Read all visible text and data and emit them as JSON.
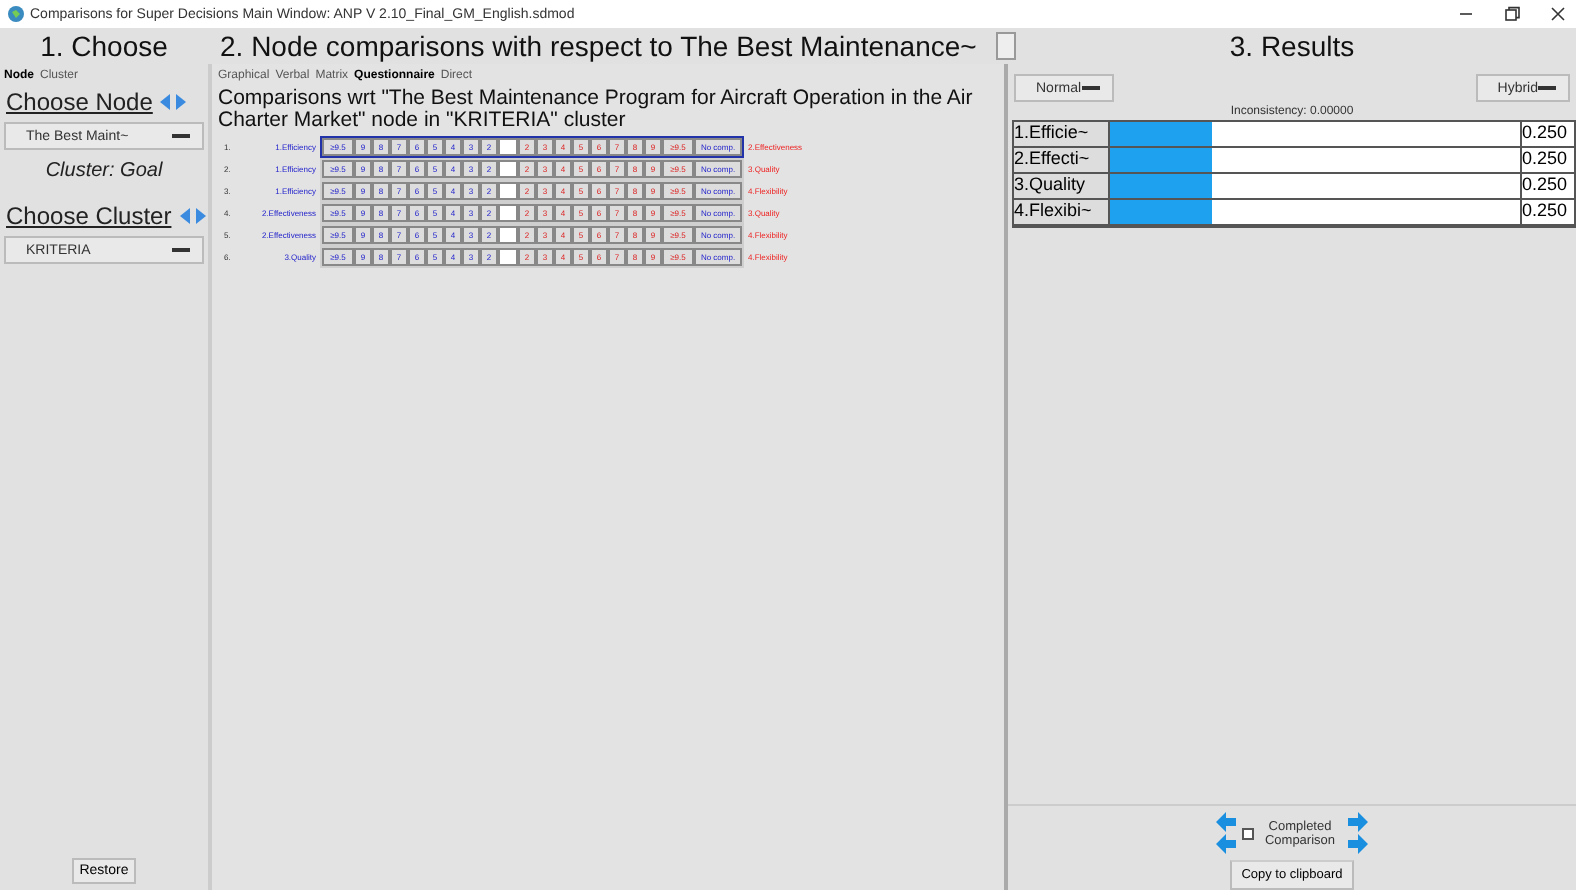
{
  "window": {
    "title": "Comparisons for Super Decisions Main Window: ANP V 2.10_Final_GM_English.sdmod"
  },
  "headers": [
    "1. Choose",
    "2. Node comparisons with respect to The Best Maintenance~",
    "3. Results"
  ],
  "choose": {
    "tabs": [
      {
        "label": "Node",
        "selected": true
      },
      {
        "label": "Cluster",
        "selected": false
      }
    ],
    "node_heading": "Choose Node",
    "node_select": "The Best Maint~",
    "cluster_info": "Cluster: Goal",
    "cluster_heading": "Choose Cluster",
    "cluster_select": "KRITERIA",
    "restore": "Restore"
  },
  "comparisons": {
    "tabs": [
      {
        "label": "Graphical",
        "selected": false
      },
      {
        "label": "Verbal",
        "selected": false
      },
      {
        "label": "Matrix",
        "selected": false
      },
      {
        "label": "Questionnaire",
        "selected": true
      },
      {
        "label": "Direct",
        "selected": false
      }
    ],
    "heading": "Comparisons wrt \"The Best Maintenance Program for Aircraft Operation in the Air Charter Market\" node in \"KRITERIA\" cluster",
    "rows": [
      {
        "number": "1.",
        "left": "1.Efficiency",
        "right": "2.Effectiveness",
        "selected": true,
        "left_scale": [
          "≥9.5",
          "9",
          "8",
          "7",
          "6",
          "5",
          "4",
          "3",
          "2"
        ],
        "right_scale": [
          "2",
          "3",
          "4",
          "5",
          "6",
          "7",
          "8",
          "9",
          "≥9.5",
          "No comp."
        ]
      },
      {
        "number": "2.",
        "left": "1.Efficiency",
        "right": "3.Quality",
        "selected": false,
        "left_scale": [
          "≥9.5",
          "9",
          "8",
          "7",
          "6",
          "5",
          "4",
          "3",
          "2"
        ],
        "right_scale": [
          "2",
          "3",
          "4",
          "5",
          "6",
          "7",
          "8",
          "9",
          "≥9.5",
          "No comp."
        ]
      },
      {
        "number": "3.",
        "left": "1.Efficiency",
        "right": "4.Flexibility",
        "selected": false,
        "left_scale": [
          "≥9.5",
          "9",
          "8",
          "7",
          "6",
          "5",
          "4",
          "3",
          "2"
        ],
        "right_scale": [
          "2",
          "3",
          "4",
          "5",
          "6",
          "7",
          "8",
          "9",
          "≥9.5",
          "No comp."
        ]
      },
      {
        "number": "4.",
        "left": "2.Effectiveness",
        "right": "3.Quality",
        "selected": false,
        "left_scale": [
          "≥9.5",
          "9",
          "8",
          "7",
          "6",
          "5",
          "4",
          "3",
          "2"
        ],
        "right_scale": [
          "2",
          "3",
          "4",
          "5",
          "6",
          "7",
          "8",
          "9",
          "≥9.5",
          "No comp."
        ]
      },
      {
        "number": "5.",
        "left": "2.Effectiveness",
        "right": "4.Flexibility",
        "selected": false,
        "left_scale": [
          "≥9.5",
          "9",
          "8",
          "7",
          "6",
          "5",
          "4",
          "3",
          "2"
        ],
        "right_scale": [
          "2",
          "3",
          "4",
          "5",
          "6",
          "7",
          "8",
          "9",
          "≥9.5",
          "No comp."
        ]
      },
      {
        "number": "6.",
        "left": "3.Quality",
        "right": "4.Flexibility",
        "selected": false,
        "left_scale": [
          "≥9.5",
          "9",
          "8",
          "7",
          "6",
          "5",
          "4",
          "3",
          "2"
        ],
        "right_scale": [
          "2",
          "3",
          "4",
          "5",
          "6",
          "7",
          "8",
          "9",
          "≥9.5",
          "No comp."
        ]
      }
    ]
  },
  "results": {
    "mode": "Normal",
    "view": "Hybrid",
    "inconsistency": "Inconsistency: 0.00000",
    "rows": [
      {
        "label": "1.Efficie~",
        "level": 0.25,
        "value": "0.250"
      },
      {
        "label": "2.Effecti~",
        "level": 0.25,
        "value": "0.250"
      },
      {
        "label": "3.Quality",
        "level": 0.25,
        "value": "0.250"
      },
      {
        "label": "4.Flexibi~",
        "level": 0.25,
        "value": "0.250"
      }
    ],
    "completed": {
      "label": "Completed Comparison",
      "checked": false
    },
    "copy": "Copy to clipboard"
  }
}
